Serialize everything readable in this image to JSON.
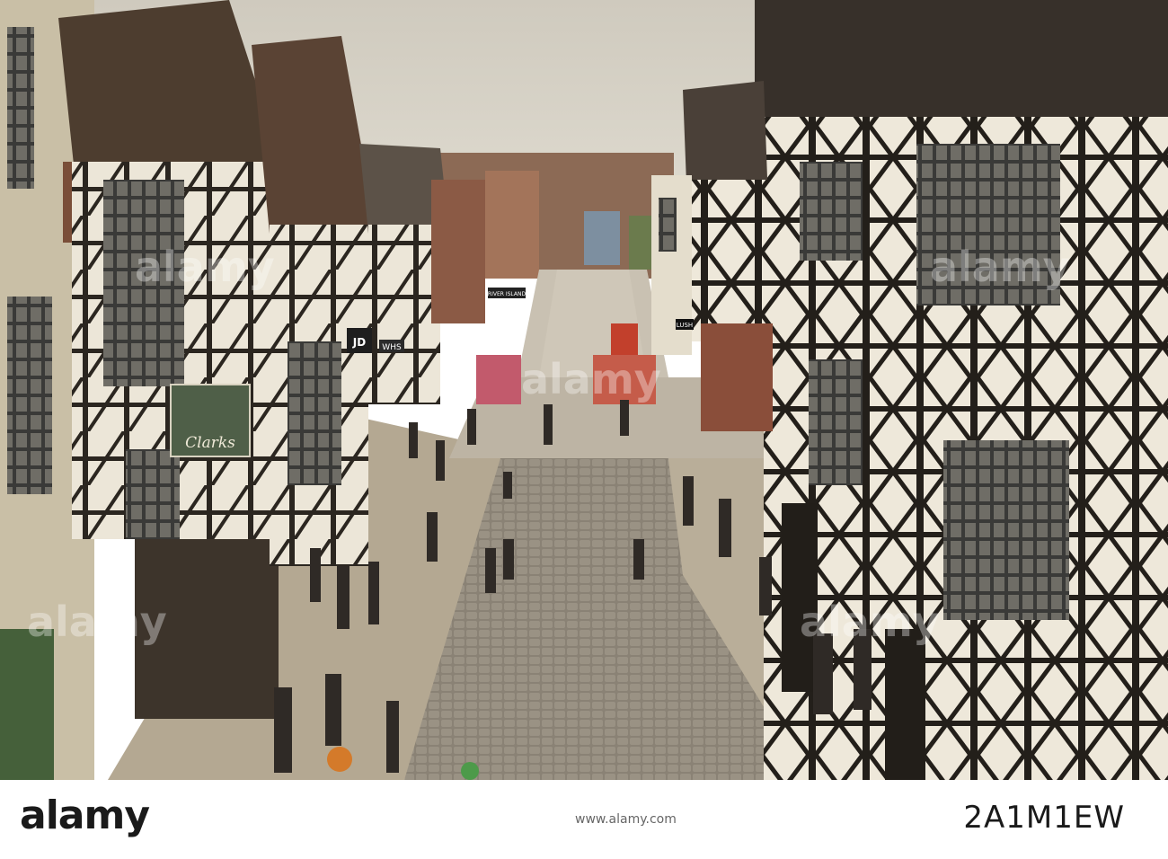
{
  "photo": {
    "signs": {
      "clarks": "Clarks",
      "jd": "JD",
      "whs": "WHS",
      "river_island": "RIVER ISLAND",
      "lush": "LUSH"
    },
    "watermark": "alamy"
  },
  "footer": {
    "brand": "alamy",
    "image_id": "2A1M1EW",
    "caption": "www.alamy.com"
  },
  "colors": {
    "timber": "#2b2620",
    "plaster": "#e9e2d2",
    "sky": "#d8d3c7",
    "cobble": "#8d8478",
    "pavement": "#b7ab97"
  }
}
